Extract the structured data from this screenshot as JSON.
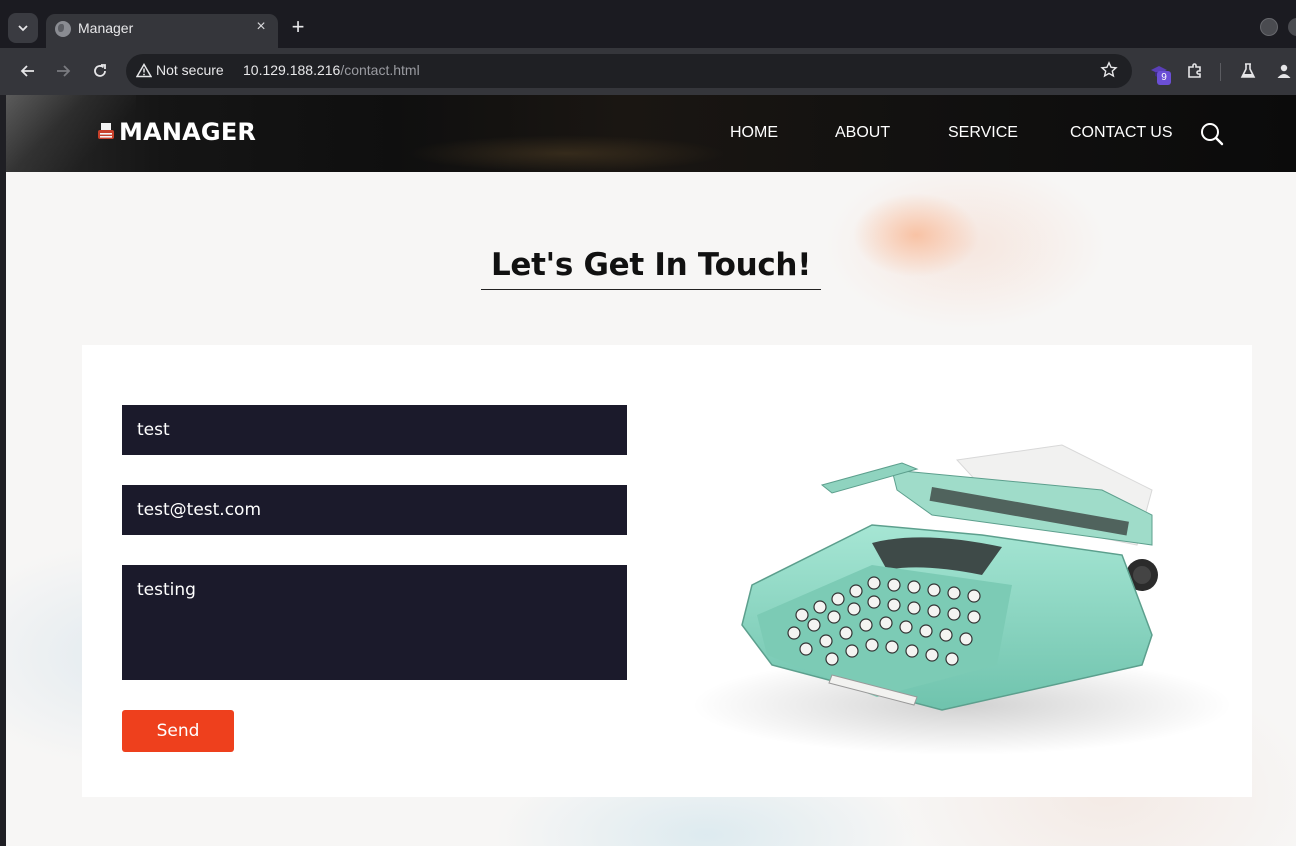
{
  "browser": {
    "tab_title": "Manager",
    "tab_close": "×",
    "new_tab": "+",
    "security_label": "Not secure",
    "url_host": "10.129.188.216",
    "url_path": "/contact.html",
    "extension_badge": "9"
  },
  "site": {
    "brand": "MANAGER",
    "nav": [
      "HOME",
      "ABOUT",
      "SERVICE",
      "CONTACT US"
    ]
  },
  "contact": {
    "heading": "Let's Get In Touch!",
    "name_value": "test",
    "email_value": "test@test.com",
    "message_value": "testing",
    "send_label": "Send"
  },
  "colors": {
    "accent": "#ee401d",
    "field_bg": "#1b1a2b",
    "typewriter_body": "#8fdcc6"
  }
}
